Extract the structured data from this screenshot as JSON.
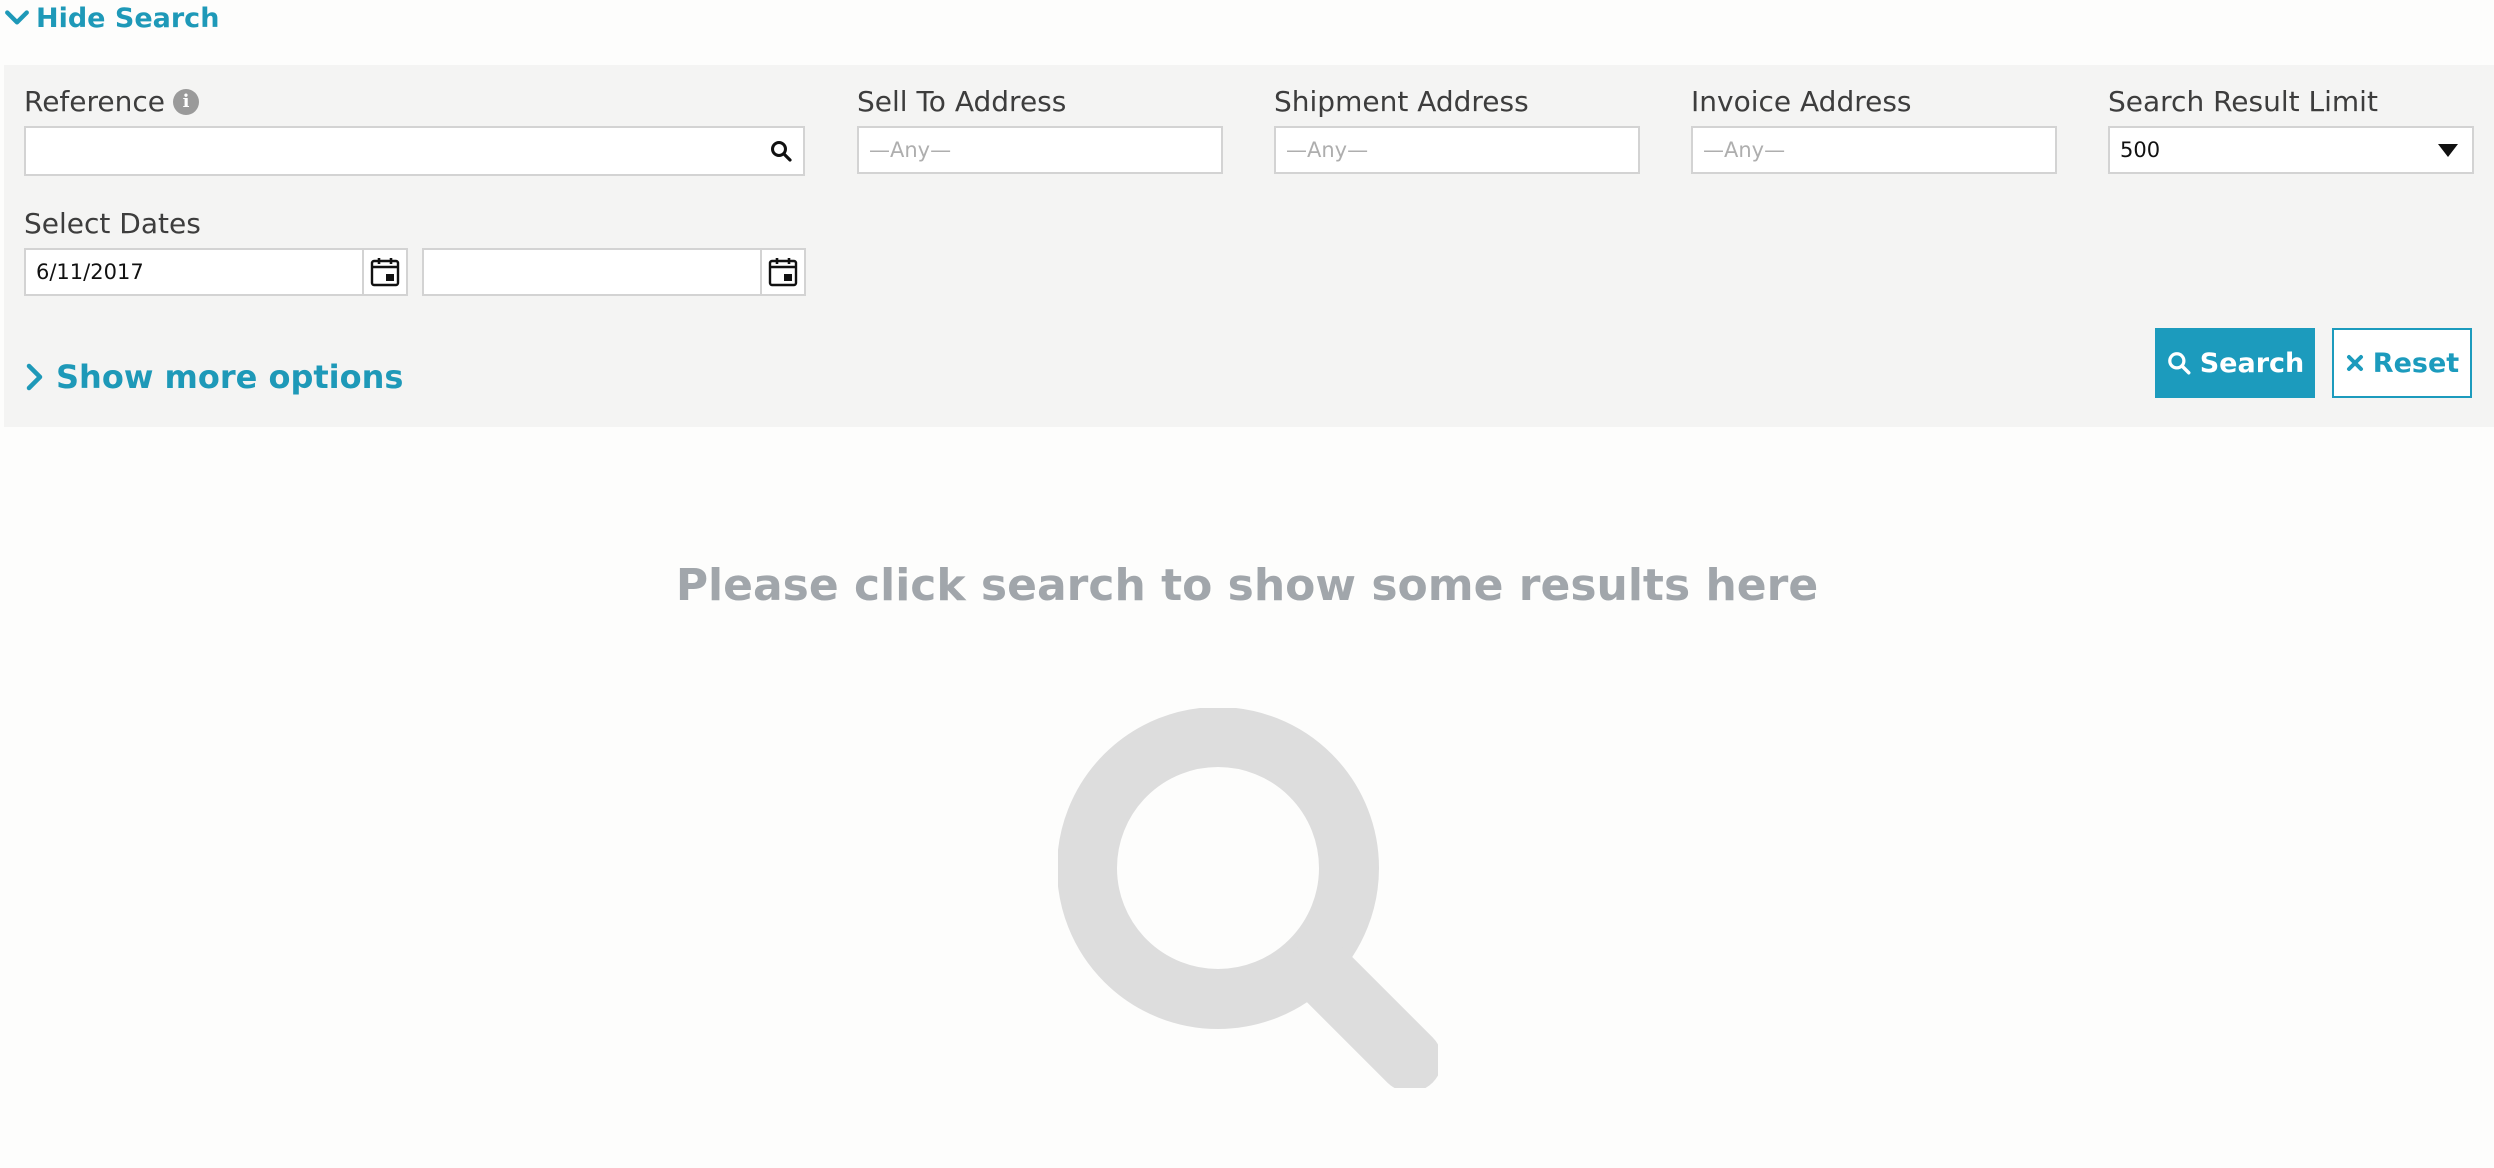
{
  "toggle": {
    "hide_search_label": "Hide Search"
  },
  "filters": {
    "reference": {
      "label": "Reference",
      "value": ""
    },
    "sell_to": {
      "label": "Sell To Address",
      "placeholder": "—Any—"
    },
    "shipment": {
      "label": "Shipment Address",
      "placeholder": "—Any—"
    },
    "invoice": {
      "label": "Invoice Address",
      "placeholder": "—Any—"
    },
    "limit": {
      "label": "Search Result Limit",
      "value": "500"
    },
    "dates": {
      "label": "Select Dates",
      "from": "6/11/2017",
      "to": ""
    }
  },
  "actions": {
    "show_more_label": "Show more options",
    "search_label": "Search",
    "reset_label": "Reset"
  },
  "empty_state": {
    "message": "Please click search to show some results here"
  },
  "colors": {
    "accent": "#1c9bbd",
    "panel": "#f4f4f3",
    "muted": "#a1a6ab"
  }
}
